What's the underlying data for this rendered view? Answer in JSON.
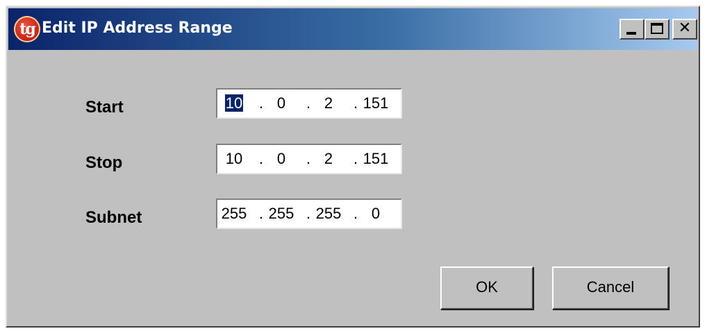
{
  "window": {
    "title": "Edit IP Address Range",
    "app_icon_text": "tg",
    "buttons": {
      "close_glyph": "✕"
    }
  },
  "fields": {
    "start": {
      "label": "Start",
      "octets": [
        "10",
        "0",
        "2",
        "151"
      ],
      "separator": ".",
      "selected_octet": 0
    },
    "stop": {
      "label": "Stop",
      "octets": [
        "10",
        "0",
        "2",
        "151"
      ],
      "separator": "."
    },
    "subnet": {
      "label": "Subnet",
      "octets": [
        "255",
        "255",
        "255",
        "0"
      ],
      "separator": "."
    }
  },
  "actions": {
    "ok_label": "OK",
    "cancel_label": "Cancel"
  },
  "colors": {
    "title_gradient_start": "#0a246a",
    "title_gradient_end": "#a6caf0",
    "face": "#c0c0c0",
    "selection": "#0a246a"
  }
}
